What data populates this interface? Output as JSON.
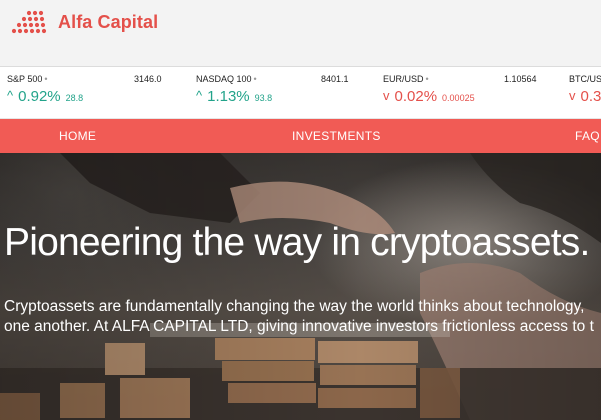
{
  "brand": {
    "name": "Alfa Capital",
    "logo_icon": "dot-triangle-logo-icon",
    "accent_color": "#e4504a"
  },
  "ticker": [
    {
      "name": "S&P 500",
      "price": "3146.0",
      "direction": "up",
      "change_pct": "0.92%",
      "change_abs": "28.8"
    },
    {
      "name": "NASDAQ 100",
      "price": "8401.1",
      "direction": "up",
      "change_pct": "1.13%",
      "change_abs": "93.8"
    },
    {
      "name": "EUR/USD",
      "price": "1.10564",
      "direction": "down",
      "change_pct": "0.02%",
      "change_abs": "0.00025"
    },
    {
      "name": "BTC/USD",
      "price": "",
      "direction": "down",
      "change_pct": "0.3",
      "change_abs": ""
    }
  ],
  "nav": {
    "items": [
      "HOME",
      "INVESTMENTS",
      "FAQ"
    ],
    "background": "#f15b55"
  },
  "hero": {
    "title": "Pioneering the way in cryptoassets.",
    "text_line1": "Cryptoassets are fundamentally changing the way the world thinks about technology,",
    "text_line2": "one another. At ALFA CAPITAL LTD, giving innovative investors frictionless access to t"
  },
  "colors": {
    "up": "#22a38a",
    "down": "#e4504a"
  }
}
